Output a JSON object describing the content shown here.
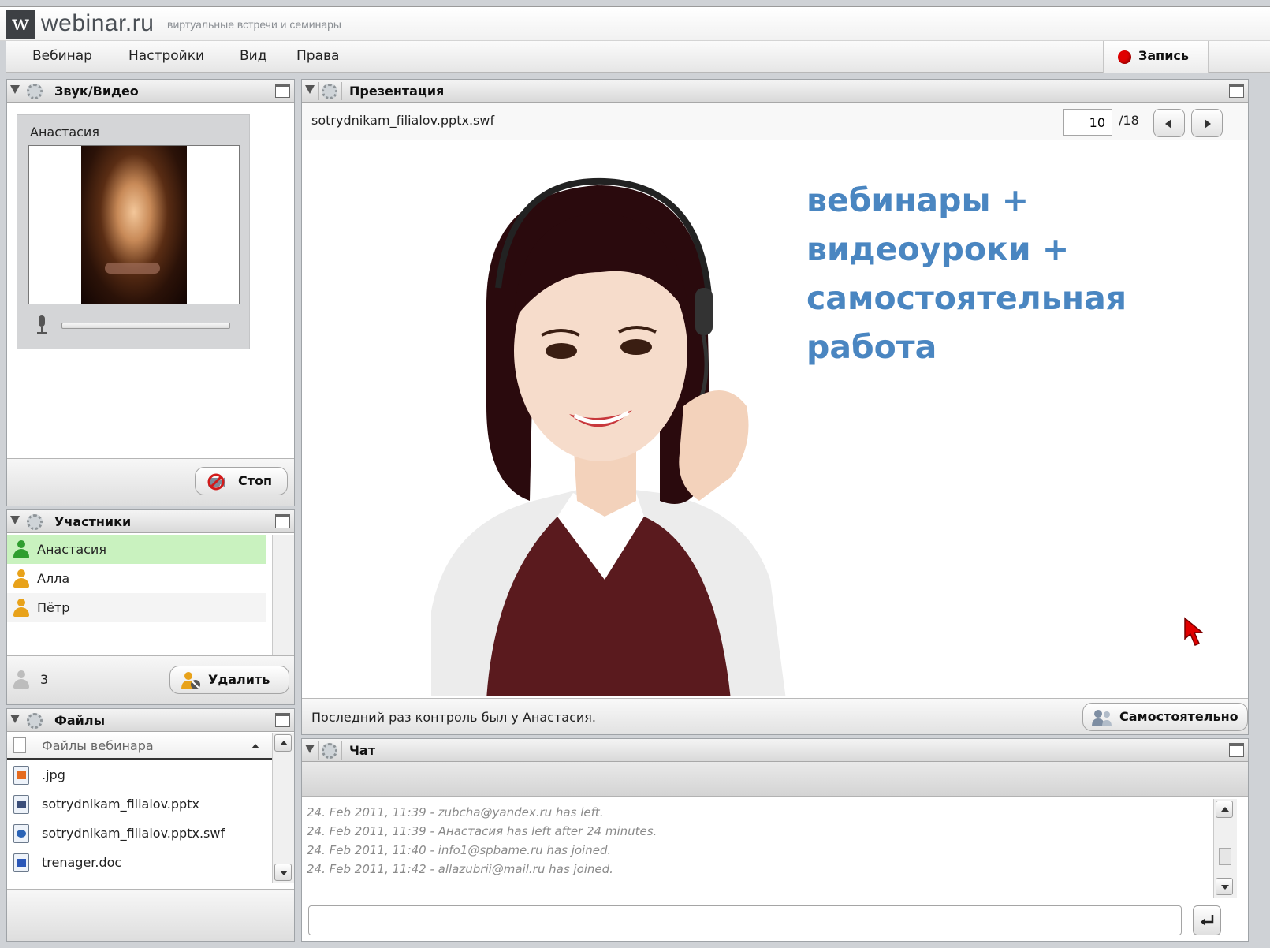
{
  "brand": {
    "logo_letter": "w",
    "name": "webinar.ru",
    "tagline": "виртуальные встречи и семинары"
  },
  "menu": {
    "items": [
      "Вебинар",
      "Настройки",
      "Вид",
      "Права"
    ],
    "record_label": "Запись"
  },
  "av_panel": {
    "title": "Звук/Видео",
    "speaker_name": "Анастасия",
    "stop_label": "Стоп"
  },
  "participants_panel": {
    "title": "Участники",
    "people": [
      {
        "name": "Анастасия",
        "color": "#2f9e2f"
      },
      {
        "name": "Алла",
        "color": "#e8a21a"
      },
      {
        "name": "Пётр",
        "color": "#e8a21a"
      }
    ],
    "count": "3",
    "remove_label": "Удалить"
  },
  "files_panel": {
    "title": "Файлы",
    "header": "Файлы вебинара",
    "files": [
      ".jpg",
      "sotrydnikam_filialov.pptx",
      "sotrydnikam_filialov.pptx.swf",
      "trenager.doc"
    ]
  },
  "presentation_panel": {
    "title": "Презентация",
    "file_name": "sotrydnikam_filialov.pptx.swf",
    "page_current": "10",
    "page_total": "/18",
    "slide_lines": [
      "вебинары +",
      "видеоуроки +",
      "самостоятельная",
      "работа"
    ],
    "status_text": "Последний раз контроль был у Анастасия.",
    "self_label": "Самостоятельно"
  },
  "chat_panel": {
    "title": "Чат",
    "messages": [
      "24. Feb 2011, 11:39 - zubcha@yandex.ru has left.",
      "24. Feb 2011, 11:39 - Анастасия has left after 24 minutes.",
      "24. Feb 2011, 11:40 - info1@spbame.ru has joined.",
      "24. Feb 2011, 11:42 - allazubrii@mail.ru has joined."
    ],
    "input_placeholder": ""
  },
  "colors": {
    "slide_text": "#4a86c1",
    "record": "#e00000",
    "active_participant_bg": "#c9f2bf"
  }
}
